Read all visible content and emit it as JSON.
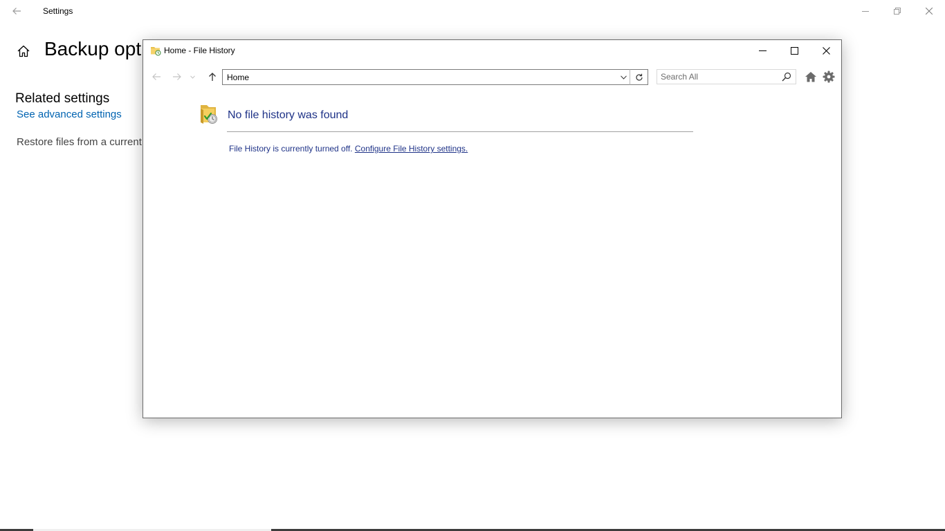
{
  "settings": {
    "title": "Settings",
    "heading": "Backup options",
    "related_heading": "Related settings",
    "advanced_link": "See advanced settings",
    "restore_text": "Restore files from a current backup"
  },
  "file_history": {
    "title": "Home - File History",
    "address_value": "Home",
    "search_placeholder": "Search All",
    "heading": "No file history was found",
    "status_text": "File History is currently turned off.",
    "status_link": "Configure File History settings."
  },
  "colors": {
    "link_blue": "#0063b1",
    "heading_blue": "#1e3287"
  },
  "icons": {
    "settings_back": "back-arrow-icon",
    "settings_home": "home-icon",
    "folder": "file-history-folder-icon",
    "search": "search-icon",
    "home_tool": "home-icon",
    "gear_tool": "gear-icon"
  }
}
